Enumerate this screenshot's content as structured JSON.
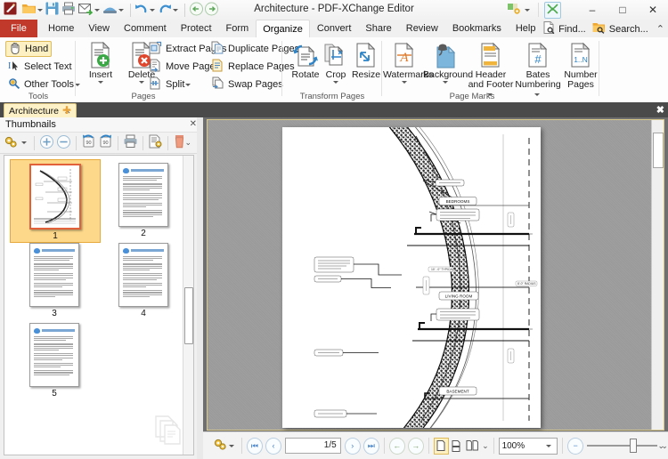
{
  "window": {
    "title": "Architecture - PDF-XChange Editor",
    "minimize": "–",
    "maximize": "□",
    "close": "✕",
    "fullscreen_icon": "fullscreen-icon",
    "customize_icon": "customize-quick-access-icon"
  },
  "quick_access": {
    "items": [
      {
        "name": "app-logo",
        "label": ""
      },
      {
        "name": "open-icon",
        "label": ""
      },
      {
        "name": "save-icon",
        "label": ""
      },
      {
        "name": "print-icon",
        "label": ""
      },
      {
        "name": "email-icon",
        "label": ""
      },
      {
        "name": "scan-icon",
        "label": ""
      },
      {
        "name": "undo-icon",
        "label": ""
      },
      {
        "name": "redo-icon",
        "label": ""
      },
      {
        "name": "back-icon",
        "label": ""
      },
      {
        "name": "forward-icon",
        "label": ""
      }
    ]
  },
  "ribbon": {
    "file_tab": "File",
    "tabs": [
      {
        "label": "Home",
        "active": false
      },
      {
        "label": "View",
        "active": false
      },
      {
        "label": "Comment",
        "active": false
      },
      {
        "label": "Protect",
        "active": false
      },
      {
        "label": "Form",
        "active": false
      },
      {
        "label": "Organize",
        "active": true
      },
      {
        "label": "Convert",
        "active": false
      },
      {
        "label": "Share",
        "active": false
      },
      {
        "label": "Review",
        "active": false
      },
      {
        "label": "Bookmarks",
        "active": false
      },
      {
        "label": "Help",
        "active": false
      }
    ],
    "find": "Find...",
    "search": "Search...",
    "collapse_caret": "⌃",
    "groups": [
      {
        "name": "tools",
        "label": "Tools",
        "items": [
          {
            "label": "Hand",
            "selected": true
          },
          {
            "label": "Select Text",
            "selected": false
          },
          {
            "label": "Other Tools",
            "selected": false,
            "has_caret": true
          }
        ]
      },
      {
        "name": "pages",
        "label": "Pages",
        "big": [
          {
            "label": "Insert",
            "caret": true
          },
          {
            "label": "Delete",
            "caret": true
          }
        ],
        "small": [
          {
            "label": "Extract Pages"
          },
          {
            "label": "Move Pages"
          },
          {
            "label": "Split",
            "caret": true
          },
          {
            "label": "Duplicate Pages"
          },
          {
            "label": "Replace Pages"
          },
          {
            "label": "Swap Pages"
          }
        ]
      },
      {
        "name": "transform-pages",
        "label": "Transform Pages",
        "big": [
          {
            "label": "Rotate",
            "caret": false
          },
          {
            "label": "Crop",
            "caret": true
          },
          {
            "label": "Resize",
            "caret": false
          }
        ]
      },
      {
        "name": "page-marks",
        "label": "Page Marks",
        "big": [
          {
            "label": "Watermarks",
            "caret": true
          },
          {
            "label": "Background",
            "caret": true
          },
          {
            "label": "Header and Footer",
            "caret": true
          },
          {
            "label": "Bates Numbering",
            "caret": true
          },
          {
            "label": "Number Pages",
            "caret": false
          }
        ]
      }
    ]
  },
  "document_tabs": {
    "active": "Architecture",
    "close": "✕",
    "new_tab": "✚",
    "pane_close": "✖"
  },
  "thumbnails_panel": {
    "title": "Thumbnails",
    "close": "✕",
    "toolbar": [
      {
        "name": "options-gear-icon",
        "caret": true
      },
      {
        "name": "zoom-in-icon"
      },
      {
        "name": "zoom-out-icon"
      },
      {
        "name": "rotate-left-icon"
      },
      {
        "name": "rotate-right-icon"
      },
      {
        "name": "print-pages-icon"
      },
      {
        "name": "page-properties-icon"
      },
      {
        "name": "delete-pages-icon"
      }
    ],
    "pages": [
      {
        "number": "1",
        "type": "plan",
        "selected": true
      },
      {
        "number": "2",
        "type": "text",
        "selected": false
      },
      {
        "number": "3",
        "type": "text",
        "selected": false
      },
      {
        "number": "4",
        "type": "text",
        "selected": false
      },
      {
        "number": "5",
        "type": "text",
        "selected": false
      }
    ]
  },
  "document_page": {
    "labels": [
      "BEDROOMS",
      "LIVING ROOM",
      "BASEMENT"
    ],
    "callouts": [
      "HORIZ TIE ALL CURVED LENGTH / LOW ANCHOR BOLTS CAST INTO CONC CORBEL",
      "POUR LEVEL",
      "FORM SET #1",
      "8'-0\" RADIUS",
      "2\" X 10\" JOISTS @ 16\" O.C. W/ JOIST HANGER",
      "2\" X 10\" JOISTS @ 16\" O.C. W/ JOIST HANGER",
      "10' - 0\" TYPICAL"
    ]
  },
  "statusbar": {
    "settings_icon": "view-settings-icon",
    "first_page_icon": "⏮",
    "prev_page_icon": "‹",
    "page_value": "1/5",
    "next_page_icon": "›",
    "last_page_icon": "⏭",
    "back_icon": "←",
    "forward_icon": "→",
    "view_modes": [
      {
        "name": "single-page-view",
        "selected": true
      },
      {
        "name": "continuous-view",
        "selected": false
      },
      {
        "name": "two-page-view",
        "selected": false
      }
    ],
    "more_views": "⌄",
    "zoom_value": "100%",
    "zoom_out_icon": "−",
    "more_zoom": "⌄",
    "more_options": "⌄"
  }
}
